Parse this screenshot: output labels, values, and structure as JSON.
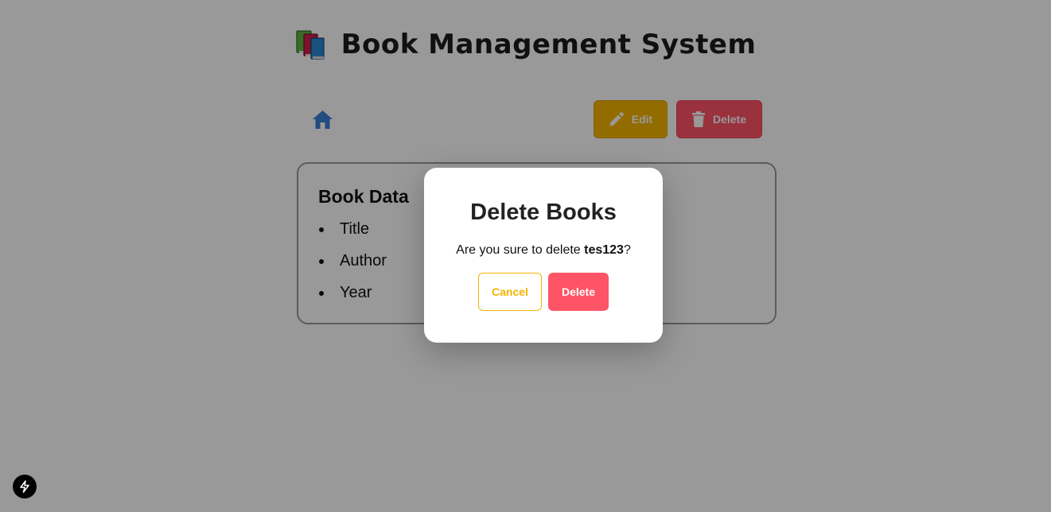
{
  "header": {
    "title": "Book Management System",
    "icon": "books-icon"
  },
  "toolbar": {
    "home_icon": "home-icon",
    "edit_label": "Edit",
    "delete_label": "Delete"
  },
  "card": {
    "title": "Book Data",
    "fields": [
      "Title",
      "Author",
      "Year"
    ]
  },
  "modal": {
    "title": "Delete Books",
    "message_prefix": "Are you sure to delete ",
    "book_name": "tes123",
    "message_suffix": "?",
    "cancel_label": "Cancel",
    "confirm_label": "Delete"
  },
  "colors": {
    "edit": "#f5b400",
    "delete": "#ff5466",
    "home": "#3b7fd6"
  }
}
